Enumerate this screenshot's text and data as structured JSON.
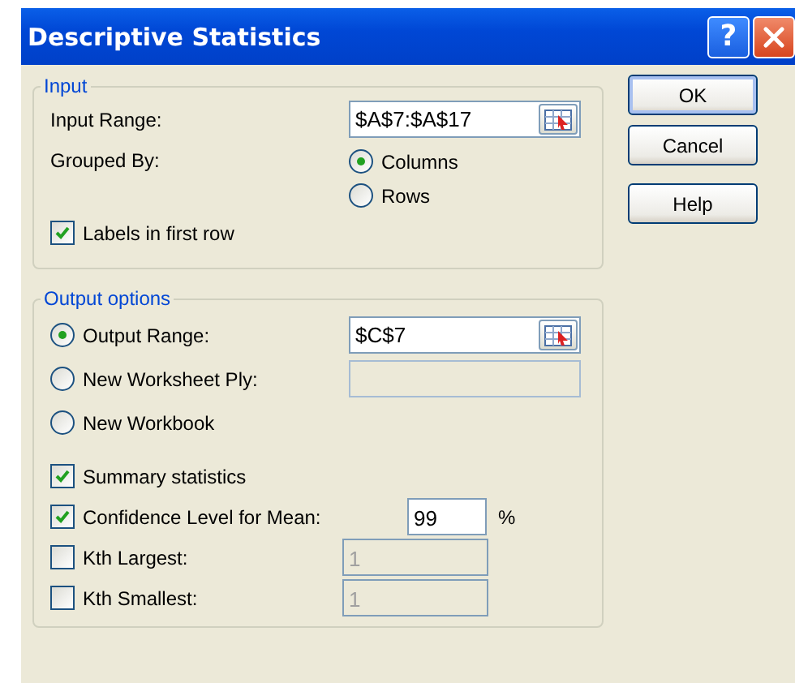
{
  "window": {
    "title": "Descriptive Statistics",
    "help_label": "?"
  },
  "input": {
    "legend": "Input",
    "input_range": {
      "label": "Input Range:",
      "value": "$A$7:$A$17"
    },
    "grouped_by": {
      "label": "Grouped By:",
      "options": [
        {
          "label": "Columns",
          "selected": true
        },
        {
          "label": "Rows",
          "selected": false
        }
      ]
    },
    "labels_in_first_row": {
      "label": "Labels in first row",
      "checked": true
    }
  },
  "output": {
    "legend": "Output options",
    "destinations": [
      {
        "label": "Output Range:",
        "selected": true,
        "field": {
          "value": "$C$7",
          "disabled": false,
          "picker": true
        }
      },
      {
        "label": "New Worksheet Ply:",
        "selected": false,
        "field": {
          "disabled": true,
          "picker": false
        }
      },
      {
        "label": "New Workbook",
        "selected": false
      }
    ],
    "options": [
      {
        "label": "Summary statistics",
        "checked": true
      },
      {
        "label": "Confidence Level for Mean:",
        "checked": true,
        "field": {
          "value": "99",
          "disabled": false
        },
        "unit": "%"
      },
      {
        "label": "Kth Largest:",
        "checked": false,
        "field": {
          "value": "1",
          "disabled": true
        }
      },
      {
        "label": "Kth Smallest:",
        "checked": false,
        "field": {
          "value": "1",
          "disabled": true
        }
      }
    ]
  },
  "buttons": [
    {
      "label": "OK",
      "default": true
    },
    {
      "label": "Cancel",
      "default": false
    },
    {
      "label": "Help",
      "default": false
    }
  ]
}
